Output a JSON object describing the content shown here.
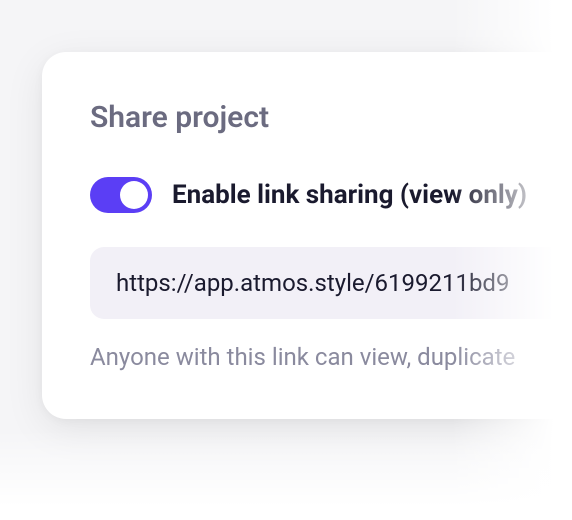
{
  "modal": {
    "title": "Share project",
    "toggle": {
      "enabled": true,
      "label": "Enable link sharing (view only)"
    },
    "share_url": "https://app.atmos.style/6199211bd9",
    "helper_text": "Anyone with this link can view, duplicate"
  },
  "colors": {
    "accent": "#5b3ef5",
    "title_text": "#6b6b80",
    "body_text": "#1a1a2e",
    "muted_text": "#8a8a9e",
    "link_bg": "#f2f0f7"
  }
}
